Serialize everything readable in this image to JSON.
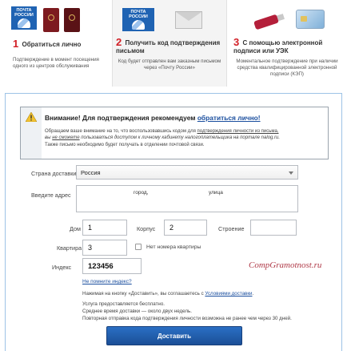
{
  "options": [
    {
      "number": "1",
      "title": "Обратиться лично",
      "description": "Подтверждение в момент посещения одного из центров обслуживания",
      "logo_text": "ПОЧТА РОССИИ"
    },
    {
      "number": "2",
      "title": "Получить код подтверждения письмом",
      "description": "Код будет отправлен вам заказным письмом через «Почту России»",
      "logo_text": "ПОЧТА РОССИИ"
    },
    {
      "number": "3",
      "title": "С помощью электронной подписи или УЭК",
      "description": "Моментальное подтверждение при наличии средства квалифицированной электронной подписи (КЭП)"
    }
  ],
  "notice": {
    "title_prefix": "Внимание! Для подтверждения рекомендуем",
    "title_link": "обратиться лично!",
    "line1_a": "Обращаем ваше внимание на то, что воспользовавшись кодом для",
    "line1_link": "подтверждения личности из письма,",
    "line2_a": "вы",
    "line2_b": "не сможете",
    "line2_c": "пользоваться доступом к личному кабинету налогоплательщика на портале nalog.ru.",
    "line3": "Также письмо необходимо будет получать в отделении почтовой связи."
  },
  "form": {
    "country_label": "Страна доставки",
    "country_value": "Россия",
    "address_label": "Введите адрес",
    "address_city": "город,",
    "address_street": "улица",
    "house_label": "Дом",
    "house_value": "1",
    "korpus_label": "Корпус",
    "korpus_value": "2",
    "stroenie_label": "Строение",
    "stroenie_value": "",
    "kvartira_label": "Квартира",
    "kvartira_value": "3",
    "no_apartment_label": "Нет номера квартиры",
    "index_label": "Индекс",
    "index_value": "123456",
    "forgot_index": "Не помните индекс?"
  },
  "watermark": "CompGramotnost.ru",
  "terms": {
    "prefix": "Нажимая на кнопку «Доставить», вы соглашаетесь с",
    "link": "Условиями доставки",
    "suffix": "."
  },
  "info_lines": [
    "Услуга предоставляется бесплатно.",
    "Среднее время доставки — около двух недель.",
    "Повторная отправка кода подтверждения личности возможна не ранее чем через 30 дней."
  ],
  "submit_label": "Доставить",
  "colors": {
    "accent_red": "#d21f26",
    "link_blue": "#1a4e9e",
    "button_blue": "#1b4f97",
    "panel_border": "#9dc3e6"
  }
}
